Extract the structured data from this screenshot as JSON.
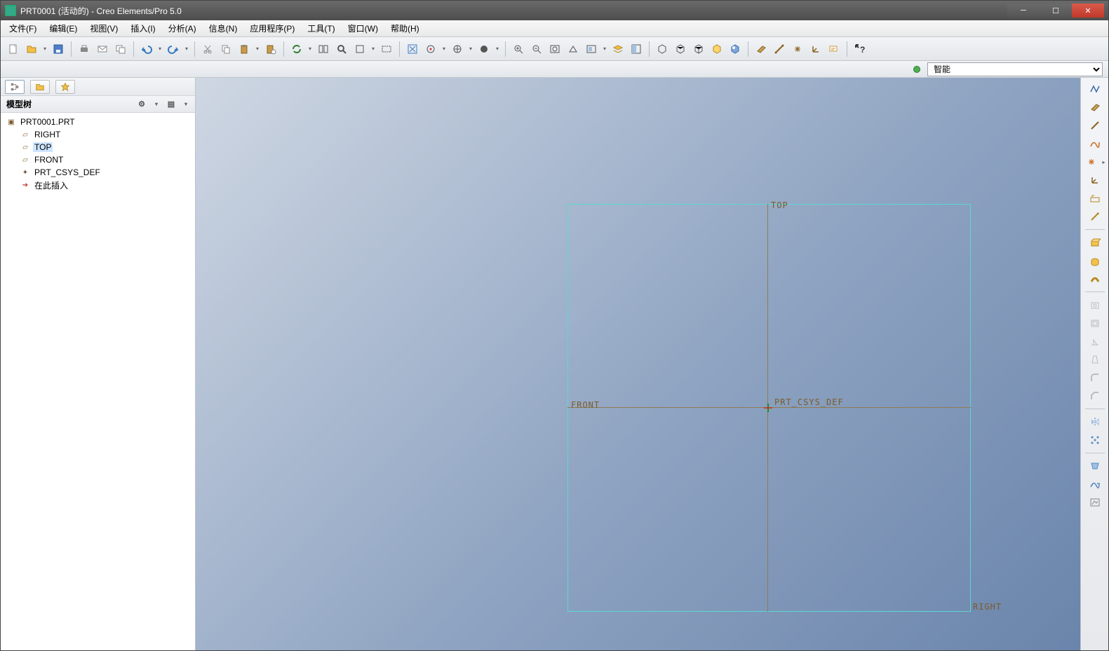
{
  "window": {
    "title": "PRT0001 (活动的) - Creo Elements/Pro 5.0"
  },
  "menu": {
    "file": "文件(F)",
    "edit": "编辑(E)",
    "view": "视图(V)",
    "insert": "插入(I)",
    "analysis": "分析(A)",
    "info": "信息(N)",
    "app": "应用程序(P)",
    "tools": "工具(T)",
    "window": "窗口(W)",
    "help": "帮助(H)"
  },
  "status": {
    "select_value": "智能"
  },
  "sidebar": {
    "panel_title": "模型树",
    "tree": {
      "root": "PRT0001.PRT",
      "nodes": [
        {
          "label": "RIGHT",
          "icon": "datum"
        },
        {
          "label": "TOP",
          "icon": "datum",
          "selected": true
        },
        {
          "label": "FRONT",
          "icon": "datum"
        },
        {
          "label": "PRT_CSYS_DEF",
          "icon": "csys"
        },
        {
          "label": "在此插入",
          "icon": "ins"
        }
      ]
    }
  },
  "graphics": {
    "labels": {
      "top": "TOP",
      "front": "FRONT",
      "right": "RIGHT",
      "csys": "PRT_CSYS_DEF"
    }
  },
  "icons": {
    "new": "new",
    "open": "open",
    "save": "save",
    "print": "print",
    "mail": "mail",
    "undo": "undo",
    "redo": "redo",
    "cut": "cut",
    "copy": "copy",
    "paste": "paste",
    "regen": "regen",
    "find": "find",
    "select": "select",
    "layers": "layers",
    "display": "display",
    "spin": "spin",
    "render": "render",
    "zoomin": "zoomin",
    "zoomout": "zoomout",
    "zoomfit": "zoomfit",
    "refit": "refit",
    "saved_view": "saved_view",
    "wireframe": "wireframe",
    "hidden": "hidden",
    "nohidden": "nohidden",
    "shade": "shade",
    "datum_plane": "datum_plane",
    "datum_axis": "datum_axis",
    "datum_point": "datum_point",
    "datum_csys": "datum_csys",
    "annotation": "annotation",
    "help": "help"
  }
}
